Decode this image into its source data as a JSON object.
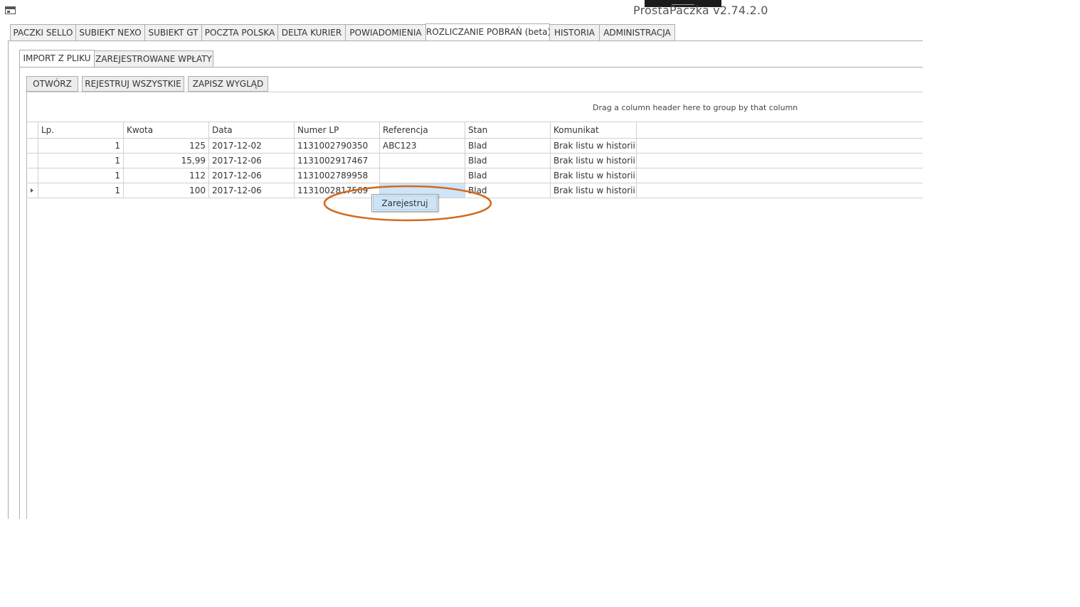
{
  "window": {
    "title": "ProstaPaczka v2.74.2.0",
    "icon": "window-icon"
  },
  "main_tabs": [
    {
      "label": "PACZKI SELLO"
    },
    {
      "label": "SUBIEKT NEXO"
    },
    {
      "label": "SUBIEKT GT"
    },
    {
      "label": "POCZTA POLSKA"
    },
    {
      "label": "DELTA KURIER"
    },
    {
      "label": "POWIADOMIENIA"
    },
    {
      "label": "ROZLICZANIE POBRAŃ (beta)"
    },
    {
      "label": "HISTORIA"
    },
    {
      "label": "ADMINISTRACJA"
    }
  ],
  "active_main_tab": "ROZLICZANIE POBRAŃ (beta)",
  "sub_tabs": [
    {
      "label": "IMPORT Z PLIKU"
    },
    {
      "label": "ZAREJESTROWANE WPŁATY"
    }
  ],
  "active_sub_tab": "IMPORT Z PLIKU",
  "toolbar": {
    "open_label": "OTWÓRZ",
    "register_all_label": "REJESTRUJ WSZYSTKIE",
    "save_layout_label": "ZAPISZ WYGLĄD"
  },
  "grid": {
    "group_panel_text": "Drag a column header here to group by that column",
    "columns": [
      "Lp.",
      "Kwota",
      "Data",
      "Numer LP",
      "Referencja",
      "Stan",
      "Komunikat"
    ],
    "rows": [
      {
        "lp": "1",
        "kwota": "125",
        "data": "2017-12-02",
        "numer_lp": "1131002790350",
        "referencja": "ABC123",
        "stan": "Blad",
        "komunikat": "Brak listu w historii..."
      },
      {
        "lp": "1",
        "kwota": "15,99",
        "data": "2017-12-06",
        "numer_lp": "1131002917467",
        "referencja": "",
        "stan": "Blad",
        "komunikat": "Brak listu w historii..."
      },
      {
        "lp": "1",
        "kwota": "112",
        "data": "2017-12-06",
        "numer_lp": "1131002789958",
        "referencja": "",
        "stan": "Blad",
        "komunikat": "Brak listu w historii..."
      },
      {
        "lp": "1",
        "kwota": "100",
        "data": "2017-12-06",
        "numer_lp": "1131002817569",
        "referencja": "",
        "stan": "Blad",
        "komunikat": "Brak listu w historii..."
      }
    ],
    "selected_row_index": 3
  },
  "context_menu": {
    "items": [
      {
        "label": "Zarejestruj"
      }
    ]
  },
  "annotation_color": "#d2691e"
}
